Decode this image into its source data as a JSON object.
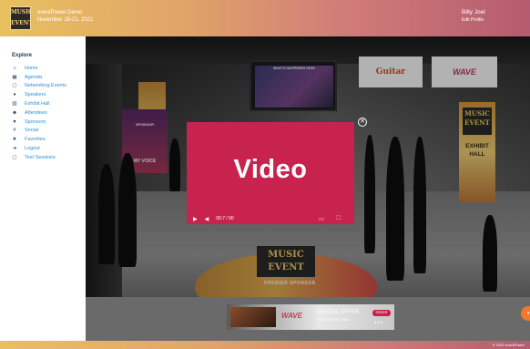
{
  "header": {
    "logo_text": "MUSIC EVENT",
    "event_title": "eventPower Demo",
    "event_date": "November 18-21, 2021",
    "user_name": "Billy Joel",
    "edit_profile_label": "Edit Profile"
  },
  "sidebar": {
    "heading": "Explore",
    "items": [
      {
        "label": "Home",
        "icon": "home-icon",
        "glyph": "⌂"
      },
      {
        "label": "Agenda",
        "icon": "agenda-icon",
        "glyph": "▦"
      },
      {
        "label": "Networking Events",
        "icon": "calendar-icon",
        "glyph": "▢"
      },
      {
        "label": "Speakers",
        "icon": "microphone-icon",
        "glyph": "♦"
      },
      {
        "label": "Exhibit Hall",
        "icon": "building-icon",
        "glyph": "▥"
      },
      {
        "label": "Attendees",
        "icon": "users-icon",
        "glyph": "☻"
      },
      {
        "label": "Sponsors",
        "icon": "sponsor-badge-icon",
        "glyph": "♥"
      },
      {
        "label": "Social",
        "icon": "hashtag-icon",
        "glyph": "#"
      },
      {
        "label": "Favorites",
        "icon": "star-icon",
        "glyph": "★"
      },
      {
        "label": "Logout",
        "icon": "logout-icon",
        "glyph": "➜"
      },
      {
        "label": "Test Sessions",
        "icon": "session-icon",
        "glyph": "▢"
      }
    ]
  },
  "scene": {
    "tv_caption": "WHAT'S HAPPENING NOW!",
    "banner_guitar": "Guitar",
    "banner_wave": "WAVE",
    "sponsor_sign_top": "SPONSOR",
    "sponsor_sign_bottom": "MY VOICE",
    "pillar_logo": "MUSIC EVENT",
    "pillar_text": "EXHIBIT HALL",
    "floor_logo": "MUSIC EVENT",
    "floor_text": "PREMIER SPONSOR"
  },
  "video": {
    "label": "Video",
    "time": "00:7 / 00",
    "close_glyph": "✕"
  },
  "ad": {
    "brand": "WAVE",
    "offer": "SPECIAL OFFER",
    "offer_sub": "LIMITED TIME ONLY",
    "button": "ORDER",
    "dots": "●●●"
  },
  "footer": {
    "copyright": "© 2020 eventPower"
  },
  "colors": {
    "accent": "#c8234f",
    "nav_link": "#2e8fd6",
    "nav_icon": "#1f3f6e",
    "chat_button": "#f07a2a"
  }
}
